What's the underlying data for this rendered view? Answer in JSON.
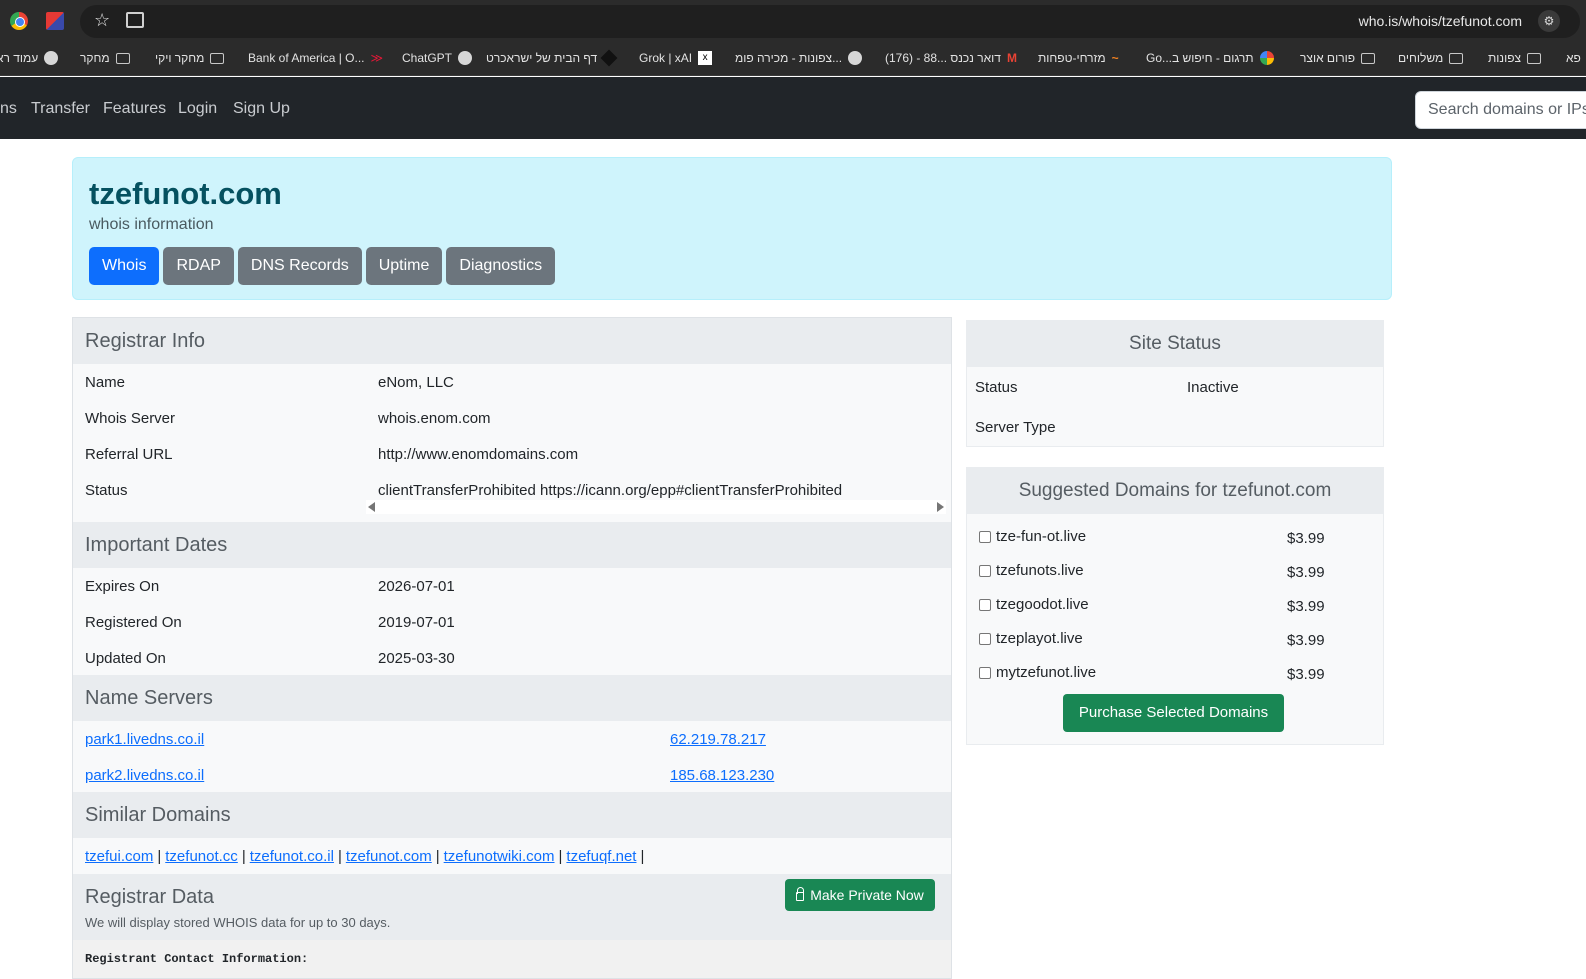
{
  "browser": {
    "url": "who.is/whois/tzefunot.com",
    "bookmarks": [
      {
        "label": "עמוד רא",
        "icon": "globe"
      },
      {
        "label": "מחקר",
        "icon": "folder"
      },
      {
        "label": "מחקר ויקי",
        "icon": "folder"
      },
      {
        "label": "Bank of America | O...",
        "icon": "bank"
      },
      {
        "label": "ChatGPT",
        "icon": "openai"
      },
      {
        "label": "דף הבית של ישראכרט",
        "icon": "isracard"
      },
      {
        "label": "Grok | xAI",
        "icon": "grok"
      },
      {
        "label": "צפונות - מכירה פומ...",
        "icon": "globe"
      },
      {
        "label": "(176) - 88... דואר נכנס",
        "icon": "gmail"
      },
      {
        "label": "מזרחי-טפחות",
        "icon": "mizrahi"
      },
      {
        "label": "Go...תרגום - חיפוש ב",
        "icon": "google"
      },
      {
        "label": "פורום אוצר",
        "icon": "folder"
      },
      {
        "label": "משלוחים",
        "icon": "folder"
      },
      {
        "label": "צפונות",
        "icon": "folder"
      },
      {
        "label": "פא",
        "icon": "folder"
      }
    ]
  },
  "nav": {
    "items": [
      "ns",
      "Transfer",
      "Features",
      "Login",
      "Sign Up"
    ],
    "search_placeholder": "Search domains or IPs"
  },
  "hero": {
    "domain": "tzefunot.com",
    "subtitle": "whois information",
    "tabs": [
      "Whois",
      "RDAP",
      "DNS Records",
      "Uptime",
      "Diagnostics"
    ]
  },
  "registrar_info": {
    "title": "Registrar Info",
    "rows": [
      {
        "label": "Name",
        "value": "eNom, LLC"
      },
      {
        "label": "Whois Server",
        "value": "whois.enom.com"
      },
      {
        "label": "Referral URL",
        "value": "http://www.enomdomains.com"
      },
      {
        "label": "Status",
        "value": "clientTransferProhibited https://icann.org/epp#clientTransferProhibited"
      }
    ]
  },
  "important_dates": {
    "title": "Important Dates",
    "rows": [
      {
        "label": "Expires On",
        "value": "2026-07-01"
      },
      {
        "label": "Registered On",
        "value": "2019-07-01"
      },
      {
        "label": "Updated On",
        "value": "2025-03-30"
      }
    ]
  },
  "name_servers": {
    "title": "Name Servers",
    "rows": [
      {
        "host": "park1.livedns.co.il",
        "ip": "62.219.78.217"
      },
      {
        "host": "park2.livedns.co.il",
        "ip": "185.68.123.230"
      }
    ]
  },
  "similar_domains": {
    "title": "Similar Domains",
    "items": [
      "tzefui.com",
      "tzefunot.cc",
      "tzefunot.co.il",
      "tzefunot.com",
      "tzefunotwiki.com",
      "tzefuqf.net"
    ],
    "separator": "|"
  },
  "registrar_data": {
    "title": "Registrar Data",
    "button": "Make Private Now",
    "note": "We will display stored WHOIS data for up to 30 days.",
    "pre_line": "Registrant Contact Information:"
  },
  "site_status": {
    "title": "Site Status",
    "status_label": "Status",
    "status_value": "Inactive",
    "server_type_label": "Server Type",
    "status_color": "#dc3545"
  },
  "suggested": {
    "title": "Suggested Domains for tzefunot.com",
    "items": [
      {
        "domain": "tze-fun-ot.live",
        "price": "$3.99"
      },
      {
        "domain": "tzefunots.live",
        "price": "$3.99"
      },
      {
        "domain": "tzegoodot.live",
        "price": "$3.99"
      },
      {
        "domain": "tzeplayot.live",
        "price": "$3.99"
      },
      {
        "domain": "mytzefunot.live",
        "price": "$3.99"
      }
    ],
    "button": "Purchase Selected Domains"
  }
}
